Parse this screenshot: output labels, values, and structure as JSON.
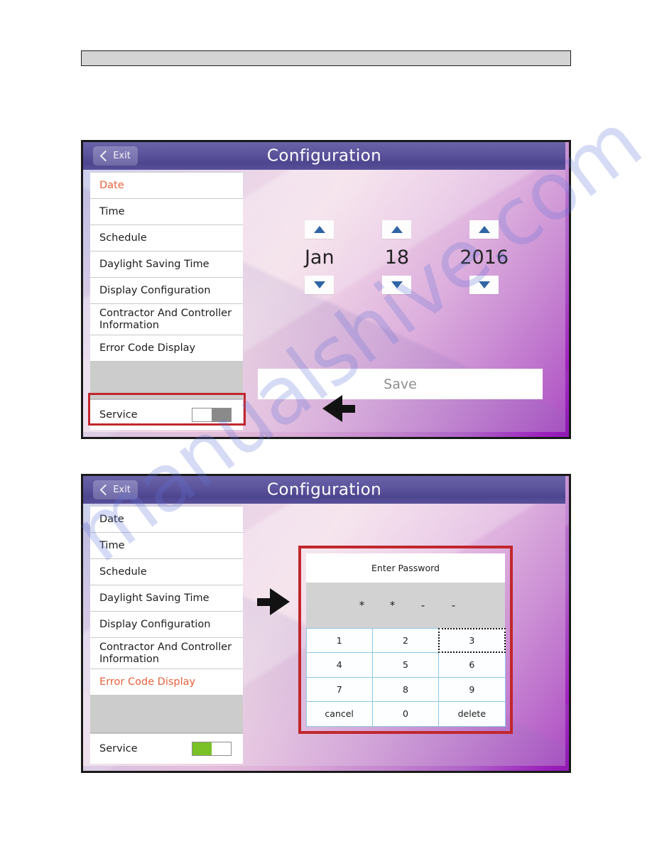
{
  "document": {
    "header_strip": ""
  },
  "watermark": {
    "text": "manualshive.com"
  },
  "colors": {
    "accent_orange": "#e8613b",
    "highlight_red": "#c1272d",
    "toggle_on_green": "#79c127",
    "toggle_off_gray": "#8a8a8a",
    "titlebar_purple": "#5d559d",
    "caret_blue": "#2f64a5"
  },
  "panels": [
    {
      "id": "panel-one",
      "titlebar": {
        "exit_label": "Exit",
        "exit_icon": "chevron-left-icon",
        "title": "Configuration"
      },
      "sidebar": {
        "items": [
          {
            "label": "Date",
            "active": true
          },
          {
            "label": "Time",
            "active": false
          },
          {
            "label": "Schedule",
            "active": false
          },
          {
            "label": "Daylight Saving Time",
            "active": false
          },
          {
            "label": "Display Configuration",
            "active": false
          },
          {
            "label": "Contractor And Controller Information",
            "active": false,
            "two_line": true
          },
          {
            "label": "Error Code Display",
            "active": false
          }
        ],
        "service": {
          "label": "Service",
          "toggle_state": "off"
        }
      },
      "content": {
        "type": "date-spinner",
        "spinners": [
          {
            "name": "month",
            "value": "Jan",
            "up_icon": "caret-up-icon",
            "down_icon": "caret-down-icon"
          },
          {
            "name": "day",
            "value": "18",
            "up_icon": "caret-up-icon",
            "down_icon": "caret-down-icon"
          },
          {
            "name": "year",
            "value": "2016",
            "up_icon": "caret-up-icon",
            "down_icon": "caret-down-icon"
          }
        ],
        "save_label": "Save"
      },
      "annotations": {
        "highlight_target": "service-row",
        "arrow_direction": "left"
      }
    },
    {
      "id": "panel-two",
      "titlebar": {
        "exit_label": "Exit",
        "exit_icon": "chevron-left-icon",
        "title": "Configuration"
      },
      "sidebar": {
        "items": [
          {
            "label": "Date",
            "active": false
          },
          {
            "label": "Time",
            "active": false
          },
          {
            "label": "Schedule",
            "active": false
          },
          {
            "label": "Daylight Saving Time",
            "active": false
          },
          {
            "label": "Display Configuration",
            "active": false
          },
          {
            "label": "Contractor And Controller Information",
            "active": false,
            "two_line": true
          },
          {
            "label": "Error Code Display",
            "active": true
          }
        ],
        "service": {
          "label": "Service",
          "toggle_state": "on"
        }
      },
      "content": {
        "type": "password-keypad",
        "title": "Enter Password",
        "display_chars": [
          "*",
          "*",
          "-",
          "-"
        ],
        "keys": [
          {
            "label": "1",
            "focused": false
          },
          {
            "label": "2",
            "focused": false
          },
          {
            "label": "3",
            "focused": true
          },
          {
            "label": "4",
            "focused": false
          },
          {
            "label": "5",
            "focused": false
          },
          {
            "label": "6",
            "focused": false
          },
          {
            "label": "7",
            "focused": false
          },
          {
            "label": "8",
            "focused": false
          },
          {
            "label": "9",
            "focused": false
          },
          {
            "label": "cancel",
            "focused": false
          },
          {
            "label": "0",
            "focused": false
          },
          {
            "label": "delete",
            "focused": false
          }
        ]
      },
      "annotations": {
        "highlight_target": "keypad",
        "arrow_direction": "right"
      }
    }
  ]
}
